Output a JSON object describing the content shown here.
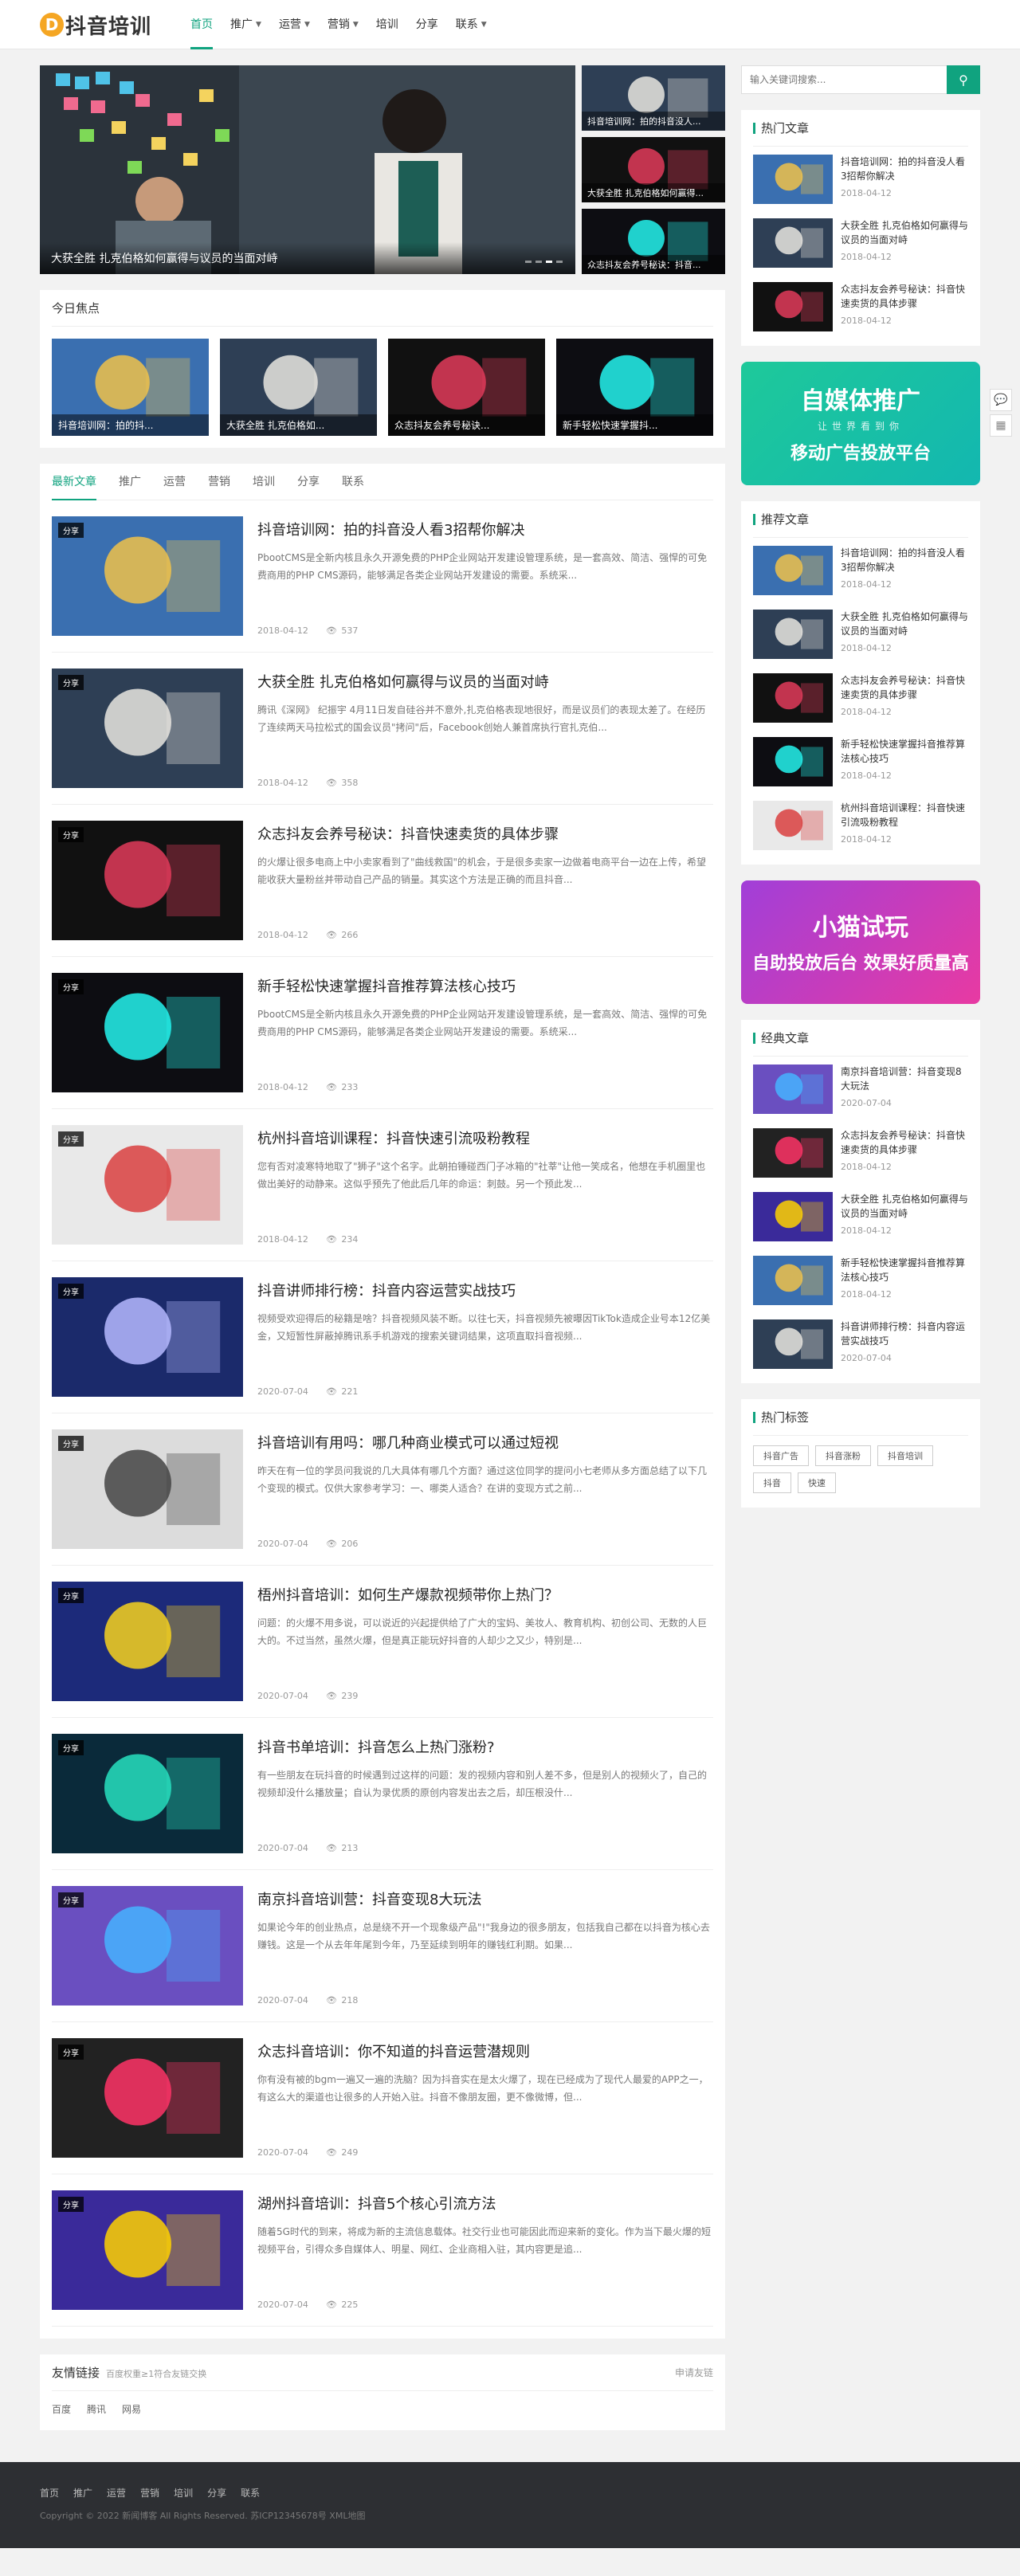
{
  "site": {
    "logo_mark": "D",
    "logo_text": "抖音培训"
  },
  "nav": [
    {
      "label": "首页",
      "active": true,
      "dropdown": false
    },
    {
      "label": "推广",
      "dropdown": true
    },
    {
      "label": "运营",
      "dropdown": true
    },
    {
      "label": "营销",
      "dropdown": true
    },
    {
      "label": "培训",
      "dropdown": false
    },
    {
      "label": "分享",
      "dropdown": false
    },
    {
      "label": "联系",
      "dropdown": true
    }
  ],
  "slider": {
    "main_caption": "大获全胜 扎克伯格如何赢得与议员的当面对峙",
    "side": [
      "抖音培训网：拍的抖音没人...",
      "大获全胜 扎克伯格如何赢得...",
      "众志抖友会养号秘诀：抖音..."
    ]
  },
  "focus": {
    "title": "今日焦点",
    "items": [
      "抖音培训网：拍的抖...",
      "大获全胜 扎克伯格如...",
      "众志抖友会养号秘诀...",
      "新手轻松快速掌握抖..."
    ]
  },
  "tabs": [
    "最新文章",
    "推广",
    "运营",
    "营销",
    "培训",
    "分享",
    "联系"
  ],
  "tag_label": "分享",
  "articles": [
    {
      "title": "抖音培训网：拍的抖音没人看3招帮你解决",
      "excerpt": "PbootCMS是全新内核且永久开源免费的PHP企业网站开发建设管理系统，是一套高效、简洁、强悍的可免费商用的PHP CMS源码，能够满足各类企业网站开发建设的需要。系统采...",
      "date": "2018-04-12",
      "views": "537"
    },
    {
      "title": "大获全胜 扎克伯格如何赢得与议员的当面对峙",
      "excerpt": "腾讯《深网》 纪振宇 4月11日发自硅谷并不意外,扎克伯格表现地很好，而是议员们的表现太差了。在经历了连续两天马拉松式的国会议员\"拷问\"后，Facebook创始人兼首席执行官扎克伯...",
      "date": "2018-04-12",
      "views": "358"
    },
    {
      "title": "众志抖友会养号秘诀：抖音快速卖货的具体步骤",
      "excerpt": "的火爆让很多电商上中小卖家看到了\"曲线救国\"的机会，于是很多卖家一边做着电商平台一边在上传，希望能收获大量粉丝并带动自己产品的销量。其实这个方法是正确的而且抖音...",
      "date": "2018-04-12",
      "views": "266"
    },
    {
      "title": "新手轻松快速掌握抖音推荐算法核心技巧",
      "excerpt": "PbootCMS是全新内核且永久开源免费的PHP企业网站开发建设管理系统，是一套高效、简洁、强悍的可免费商用的PHP CMS源码，能够满足各类企业网站开发建设的需要。系统采...",
      "date": "2018-04-12",
      "views": "233"
    },
    {
      "title": "杭州抖音培训课程：抖音快速引流吸粉教程",
      "excerpt": "您有否对凌寒特地取了\"狮子\"这个名字。此朝拍锤碰西门子冰箱的\"社莘\"让他一笑成名，他想在手机圈里也做出美好的动静来。这似乎预先了他此后几年的命运：刺鼓。另一个预此发...",
      "date": "2018-04-12",
      "views": "234"
    },
    {
      "title": "抖音讲师排行榜：抖音内容运营实战技巧",
      "excerpt": "视频受欢迎得后的秘籍是啥？抖音视频风装不断。以往七天，抖音视频先被曝因TikTok造成企业号本12亿美金，又短暂性屏蔽掉腾讯系手机游戏的搜索关键词结果，这项直取抖音视频...",
      "date": "2020-07-04",
      "views": "221"
    },
    {
      "title": "抖音培训有用吗：哪几种商业模式可以通过短视",
      "excerpt": "昨天在有一位的学员问我说的几大具体有哪几个方面？通过这位同学的提问小七老师从多方面总结了以下几个变现的模式。仅供大家参考学习：一、哪类人适合？在讲的变现方式之前...",
      "date": "2020-07-04",
      "views": "206"
    },
    {
      "title": "梧州抖音培训：如何生产爆款视频带你上热门？",
      "excerpt": "问题：的火爆不用多说，可以说近的兴起提供给了广大的宝妈、美妆人、教育机构、初创公司、无数的人巨大的。不过当然，虽然火爆，但是真正能玩好抖音的人却少之又少，特别是...",
      "date": "2020-07-04",
      "views": "239"
    },
    {
      "title": "抖音书单培训：抖音怎么上热门涨粉?",
      "excerpt": "有一些朋友在玩抖音的时候遇到过这样的问题：发的视频内容和别人差不多，但是别人的视频火了，自己的视频却没什么播放量；自认为录优质的原创内容发出去之后，却压根没什...",
      "date": "2020-07-04",
      "views": "213"
    },
    {
      "title": "南京抖音培训营：抖音变现8大玩法",
      "excerpt": "如果论今年的创业热点，总是绕不开一个现象级产品\"!\"我身边的很多朋友，包括我自己都在以抖音为核心去赚钱。这是一个从去年年尾到今年，乃至延续到明年的赚钱红利期。如果...",
      "date": "2020-07-04",
      "views": "218"
    },
    {
      "title": "众志抖音培训：你不知道的抖音运营潜规则",
      "excerpt": "你有没有被的bgm一遍又一遍的洗脑？因为抖音实在是太火爆了，现在已经成为了现代人最爱的APP之一，有这么大的渠道也让很多的人开始入驻。抖音不像朋友圈，更不像微博，但...",
      "date": "2020-07-04",
      "views": "249"
    },
    {
      "title": "湖州抖音培训：抖音5个核心引流方法",
      "excerpt": "随着5G时代的到来，将成为新的主流信息载体。社交行业也可能因此而迎来新的变化。作为当下最火爆的短视频平台，引得众多自媒体人、明星、网红、企业商相入驻，其内容更是追...",
      "date": "2020-07-04",
      "views": "225"
    }
  ],
  "friend_links": {
    "title": "友情链接",
    "subtitle": "百度权重≥1符合友链交换",
    "apply": "申请友链",
    "items": [
      "百度",
      "腾讯",
      "网易"
    ]
  },
  "search": {
    "placeholder": "输入关键词搜索..."
  },
  "hot": {
    "title": "热门文章",
    "items": [
      {
        "title": "抖音培训网：拍的抖音没人看3招帮你解决",
        "date": "2018-04-12"
      },
      {
        "title": "大获全胜 扎克伯格如何赢得与议员的当面对峙",
        "date": "2018-04-12"
      },
      {
        "title": "众志抖友会养号秘诀：抖音快速卖货的具体步骤",
        "date": "2018-04-12"
      }
    ]
  },
  "ad1": {
    "line1": "自媒体推广",
    "line2": "让世界看到你",
    "line3": "移动广告投放平台"
  },
  "recommend": {
    "title": "推荐文章",
    "items": [
      {
        "title": "抖音培训网：拍的抖音没人看3招帮你解决",
        "date": "2018-04-12"
      },
      {
        "title": "大获全胜 扎克伯格如何赢得与议员的当面对峙",
        "date": "2018-04-12"
      },
      {
        "title": "众志抖友会养号秘诀：抖音快速卖货的具体步骤",
        "date": "2018-04-12"
      },
      {
        "title": "新手轻松快速掌握抖音推荐算法核心技巧",
        "date": "2018-04-12"
      },
      {
        "title": "杭州抖音培训课程：抖音快速引流吸粉教程",
        "date": "2018-04-12"
      }
    ]
  },
  "ad2": {
    "line1": "小猫试玩",
    "line2": "",
    "line3": "自助投放后台 效果好质量高"
  },
  "classic": {
    "title": "经典文章",
    "items": [
      {
        "title": "南京抖音培训营：抖音变现8大玩法",
        "date": "2020-07-04"
      },
      {
        "title": "众志抖友会养号秘诀：抖音快速卖货的具体步骤",
        "date": "2018-04-12"
      },
      {
        "title": "大获全胜 扎克伯格如何赢得与议员的当面对峙",
        "date": "2018-04-12"
      },
      {
        "title": "新手轻松快速掌握抖音推荐算法核心技巧",
        "date": "2018-04-12"
      },
      {
        "title": "抖音讲师排行榜：抖音内容运营实战技巧",
        "date": "2020-07-04"
      }
    ]
  },
  "hot_tags": {
    "title": "热门标签",
    "items": [
      "抖音广告",
      "抖音涨粉",
      "抖音培训",
      "抖音",
      "快速"
    ]
  },
  "footer": {
    "nav": [
      "首页",
      "推广",
      "运营",
      "营销",
      "培训",
      "分享",
      "联系"
    ],
    "copyright": "Copyright © 2022 新闻博客 All Rights Reserved. 苏ICP12345678号 XML地图"
  },
  "colors": {
    "accent": "#10a37f"
  }
}
